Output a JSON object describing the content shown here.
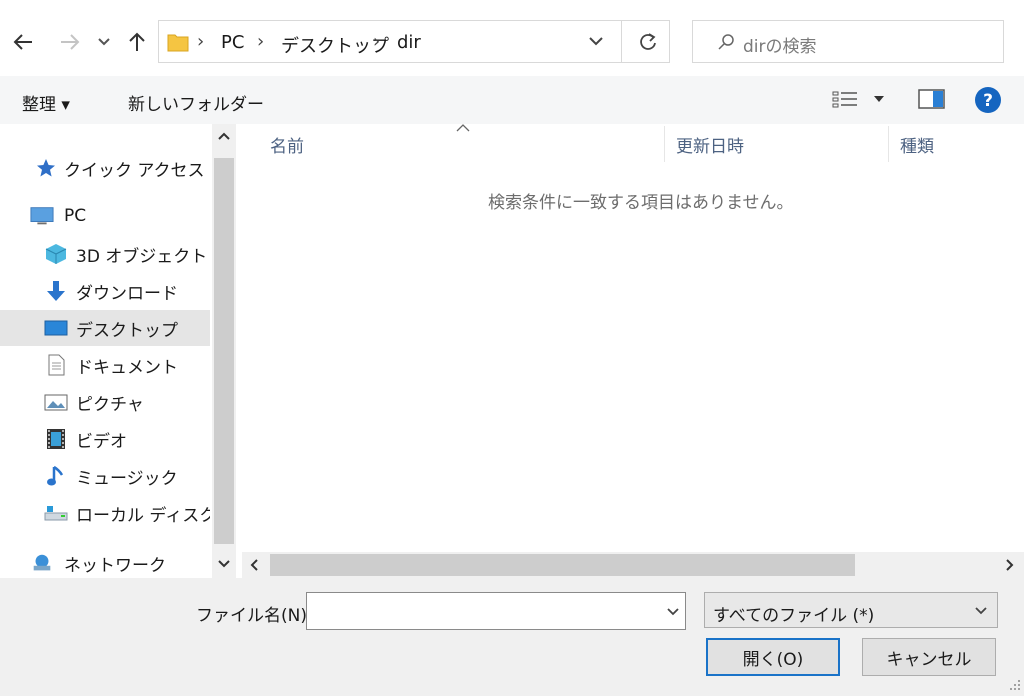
{
  "address": {
    "segments": [
      "PC",
      "デスクトップ",
      "dir"
    ]
  },
  "search": {
    "placeholder": "dirの検索"
  },
  "toolbar": {
    "organize": "整理 ▾",
    "new_folder": "新しいフォルダー"
  },
  "nav": {
    "items": [
      {
        "label": "クイック アクセス"
      },
      {
        "label": "PC"
      },
      {
        "label": "3D オブジェクト"
      },
      {
        "label": "ダウンロード"
      },
      {
        "label": "デスクトップ"
      },
      {
        "label": "ドキュメント"
      },
      {
        "label": "ピクチャ"
      },
      {
        "label": "ビデオ"
      },
      {
        "label": "ミュージック"
      },
      {
        "label": "ローカル ディスク (C"
      },
      {
        "label": "ネットワーク"
      }
    ]
  },
  "list": {
    "columns": [
      "名前",
      "更新日時",
      "種類"
    ],
    "empty_message": "検索条件に一致する項目はありません。"
  },
  "footer": {
    "filename_label": "ファイル名(N):",
    "filename_value": "",
    "filetype_value": "すべてのファイル (*)",
    "open_label": "開く(O)",
    "cancel_label": "キャンセル"
  },
  "colors": {
    "accent": "#1a73c8",
    "folder": "#f5c542",
    "help": "#1565c0"
  }
}
